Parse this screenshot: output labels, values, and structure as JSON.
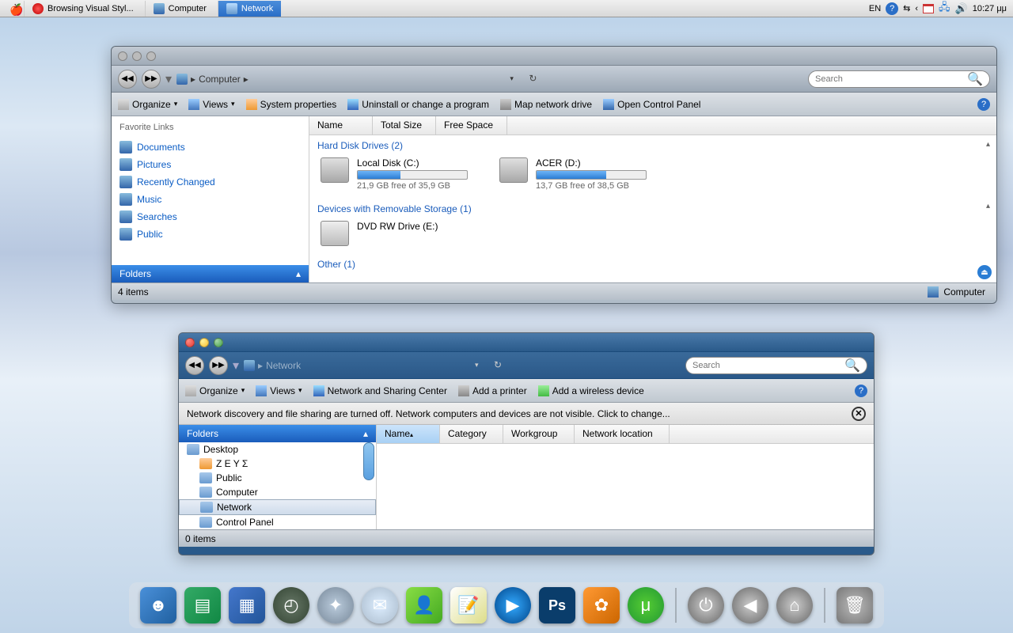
{
  "menubar": {
    "tasks": [
      {
        "label": "Browsing Visual Styl..."
      },
      {
        "label": "Computer"
      },
      {
        "label": "Network",
        "active": true
      }
    ],
    "lang": "EN",
    "clock": "10:27 μμ"
  },
  "win1": {
    "breadcrumb": "Computer",
    "search_placeholder": "Search",
    "toolbar": {
      "organize": "Organize",
      "views": "Views",
      "system_properties": "System properties",
      "uninstall": "Uninstall or change a program",
      "map_drive": "Map network drive",
      "control_panel": "Open Control Panel"
    },
    "sidebar": {
      "header": "Favorite Links",
      "items": [
        "Documents",
        "Pictures",
        "Recently Changed",
        "Music",
        "Searches",
        "Public"
      ],
      "folders_label": "Folders"
    },
    "columns": [
      "Name",
      "Total Size",
      "Free Space"
    ],
    "section_drives": "Hard Disk Drives (2)",
    "drives": [
      {
        "name": "Local Disk (C:)",
        "free": "21,9 GB free of 35,9 GB",
        "pct": 39
      },
      {
        "name": "ACER (D:)",
        "free": "13,7 GB free of 38,5 GB",
        "pct": 64
      }
    ],
    "section_removable": "Devices with Removable Storage (1)",
    "dvd": "DVD RW Drive (E:)",
    "section_other": "Other (1)",
    "status_items": "4 items",
    "status_right": "Computer"
  },
  "win2": {
    "breadcrumb": "Network",
    "search_placeholder": "Search",
    "toolbar": {
      "organize": "Organize",
      "views": "Views",
      "sharing_center": "Network and Sharing Center",
      "add_printer": "Add a printer",
      "add_wireless": "Add a wireless device"
    },
    "infobar": "Network discovery and file sharing are turned off. Network computers and devices are not visible. Click to change...",
    "folders_label": "Folders",
    "tree": [
      "Desktop",
      "Ζ Ε Υ Σ",
      "Public",
      "Computer",
      "Network",
      "Control Panel"
    ],
    "tree_selected": 4,
    "columns": [
      "Name",
      "Category",
      "Workgroup",
      "Network location"
    ],
    "status_items": "0 items"
  },
  "dock": {
    "items": [
      "finder",
      "flip3d",
      "tiles",
      "clock",
      "safari",
      "mail",
      "messenger",
      "notes",
      "wmp",
      "photoshop",
      "iphoto",
      "utorrent"
    ],
    "sys": [
      "power",
      "back",
      "home"
    ],
    "trash": "trash"
  }
}
